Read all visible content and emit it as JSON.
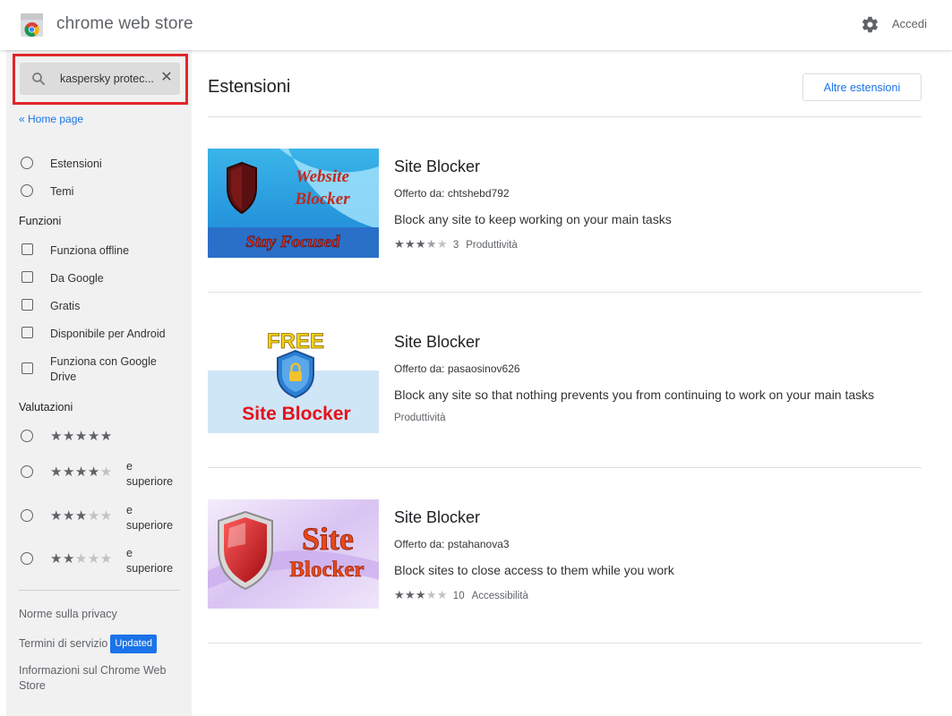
{
  "header": {
    "app_name": "chrome web store",
    "signin_label": "Accedi"
  },
  "sidebar": {
    "search": {
      "value": "kaspersky protec...",
      "placeholder": ""
    },
    "home_link": "« Home page",
    "types": [
      {
        "label": "Estensioni"
      },
      {
        "label": "Temi"
      }
    ],
    "features_title": "Funzioni",
    "features": [
      {
        "label": "Funziona offline"
      },
      {
        "label": "Da Google"
      },
      {
        "label": "Gratis"
      },
      {
        "label": "Disponibile per Android"
      },
      {
        "label_line1": "Funziona con Google",
        "label_line2": "Drive"
      }
    ],
    "ratings_title": "Valutazioni",
    "ratings": [
      {
        "stars": 5
      },
      {
        "stars": 4,
        "line1": "e",
        "line2": "superiore"
      },
      {
        "stars": 3,
        "line1": "e",
        "line2": "superiore"
      },
      {
        "stars": 2,
        "line1": "e",
        "line2": "superiore"
      }
    ],
    "footer": {
      "privacy": "Norme sulla privacy",
      "terms": "Termini di servizio",
      "terms_badge": "Updated",
      "about_line1": "Informazioni sul Chrome Web",
      "about_line2": "Store"
    }
  },
  "main": {
    "title": "Estensioni",
    "more_button": "Altre estensioni",
    "items": [
      {
        "title": "Site Blocker",
        "offered_by": "Offerto da: chtshebd792",
        "description": "Block any site to keep working on your main tasks",
        "rating": 3.5,
        "rating_count": "3",
        "category": "Produttività",
        "thumb_text1": "Website",
        "thumb_text2": "Blocker",
        "thumb_text3": "Stay Focused"
      },
      {
        "title": "Site Blocker",
        "offered_by": "Offerto da: pasaosinov626",
        "description": "Block any site so that nothing prevents you from continuing to work on your main tasks",
        "category": "Produttività",
        "thumb_text1": "FREE",
        "thumb_text2": "Site Blocker"
      },
      {
        "title": "Site Blocker",
        "offered_by": "Offerto da: pstahanova3",
        "description": "Block sites to close access to them while you work",
        "rating": 3,
        "rating_count": "10",
        "category": "Accessibilità",
        "thumb_text1": "Site",
        "thumb_text2": "Blocker"
      }
    ]
  },
  "colors": {
    "accent": "#1a73e8",
    "highlight_border": "#e0262b",
    "sidebar_bg": "#f1f1f1"
  }
}
